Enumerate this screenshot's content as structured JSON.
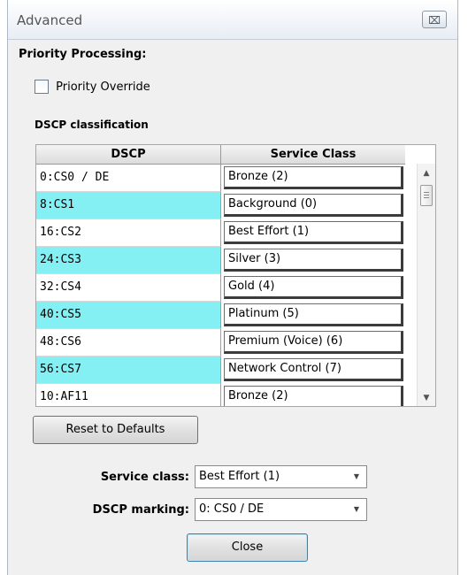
{
  "window": {
    "title": "Advanced",
    "close_glyph": "⌧"
  },
  "priority": {
    "section_title": "Priority Processing:",
    "override_label": "Priority Override",
    "override_checked": false
  },
  "dscp": {
    "section_title": "DSCP classification",
    "columns": [
      "DSCP",
      "Service Class"
    ],
    "rows": [
      {
        "dscp": "0:CS0 / DE",
        "service": "Bronze (2)",
        "highlight": false
      },
      {
        "dscp": "8:CS1",
        "service": "Background (0)",
        "highlight": true
      },
      {
        "dscp": "16:CS2",
        "service": "Best Effort (1)",
        "highlight": false
      },
      {
        "dscp": "24:CS3",
        "service": "Silver (3)",
        "highlight": true
      },
      {
        "dscp": "32:CS4",
        "service": "Gold (4)",
        "highlight": false
      },
      {
        "dscp": "40:CS5",
        "service": "Platinum (5)",
        "highlight": true
      },
      {
        "dscp": "48:CS6",
        "service": "Premium (Voice) (6)",
        "highlight": false
      },
      {
        "dscp": "56:CS7",
        "service": "Network Control (7)",
        "highlight": true
      },
      {
        "dscp": "10:AF11",
        "service": "Bronze (2)",
        "highlight": false
      }
    ],
    "highlight_color": "#84f0f3"
  },
  "buttons": {
    "reset_label": "Reset to Defaults",
    "close_label": "Close"
  },
  "fields": {
    "service_class_label": "Service class:",
    "service_class_value": "Best Effort (1)",
    "dscp_marking_label": "DSCP marking:",
    "dscp_marking_value": "0: CS0 / DE"
  },
  "icons": {
    "scroll_up": "up-arrow-icon",
    "scroll_down": "down-arrow-icon",
    "dropdown": "chevron-down-icon"
  }
}
